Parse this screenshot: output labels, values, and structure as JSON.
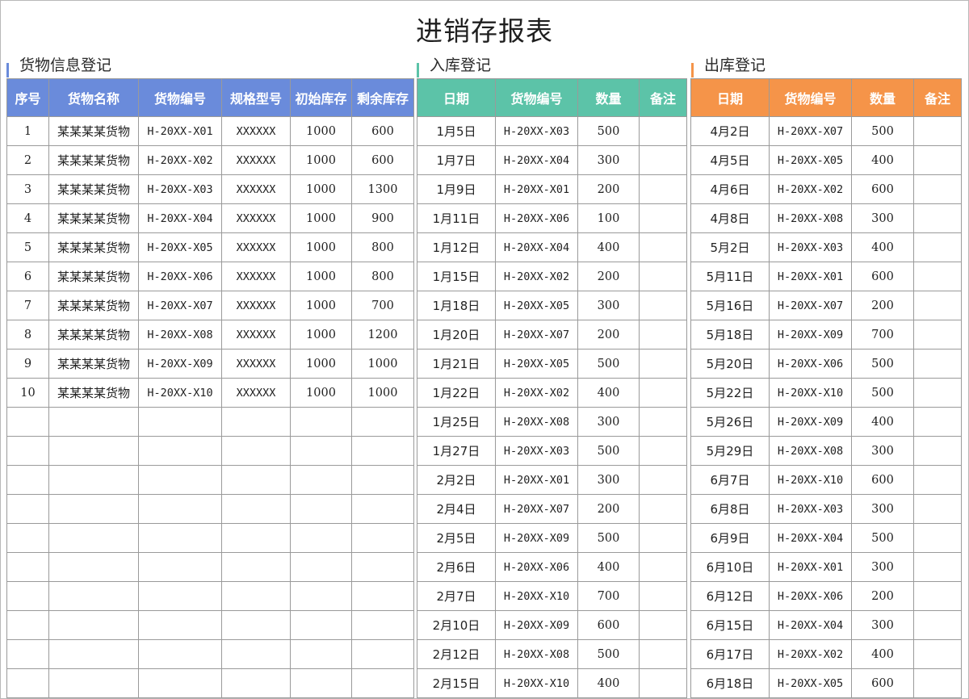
{
  "title": "进销存报表",
  "colors": {
    "goods": "#6a8bdb",
    "in": "#5cc3a8",
    "out": "#f59449"
  },
  "goods": {
    "label": "货物信息登记",
    "headers": [
      "序号",
      "货物名称",
      "货物编号",
      "规格型号",
      "初始库存",
      "剩余库存"
    ],
    "rows": [
      [
        "1",
        "某某某某货物",
        "H-20XX-X01",
        "XXXXXX",
        "1000",
        "600"
      ],
      [
        "2",
        "某某某某货物",
        "H-20XX-X02",
        "XXXXXX",
        "1000",
        "600"
      ],
      [
        "3",
        "某某某某货物",
        "H-20XX-X03",
        "XXXXXX",
        "1000",
        "1300"
      ],
      [
        "4",
        "某某某某货物",
        "H-20XX-X04",
        "XXXXXX",
        "1000",
        "900"
      ],
      [
        "5",
        "某某某某货物",
        "H-20XX-X05",
        "XXXXXX",
        "1000",
        "800"
      ],
      [
        "6",
        "某某某某货物",
        "H-20XX-X06",
        "XXXXXX",
        "1000",
        "800"
      ],
      [
        "7",
        "某某某某货物",
        "H-20XX-X07",
        "XXXXXX",
        "1000",
        "700"
      ],
      [
        "8",
        "某某某某货物",
        "H-20XX-X08",
        "XXXXXX",
        "1000",
        "1200"
      ],
      [
        "9",
        "某某某某货物",
        "H-20XX-X09",
        "XXXXXX",
        "1000",
        "1000"
      ],
      [
        "10",
        "某某某某货物",
        "H-20XX-X10",
        "XXXXXX",
        "1000",
        "1000"
      ],
      [
        "",
        "",
        "",
        "",
        "",
        ""
      ],
      [
        "",
        "",
        "",
        "",
        "",
        ""
      ],
      [
        "",
        "",
        "",
        "",
        "",
        ""
      ],
      [
        "",
        "",
        "",
        "",
        "",
        ""
      ],
      [
        "",
        "",
        "",
        "",
        "",
        ""
      ],
      [
        "",
        "",
        "",
        "",
        "",
        ""
      ],
      [
        "",
        "",
        "",
        "",
        "",
        ""
      ],
      [
        "",
        "",
        "",
        "",
        "",
        ""
      ],
      [
        "",
        "",
        "",
        "",
        "",
        ""
      ],
      [
        "",
        "",
        "",
        "",
        "",
        ""
      ]
    ]
  },
  "inbound": {
    "label": "入库登记",
    "headers": [
      "日期",
      "货物编号",
      "数量",
      "备注"
    ],
    "rows": [
      [
        "1月5日",
        "H-20XX-X03",
        "500",
        ""
      ],
      [
        "1月7日",
        "H-20XX-X04",
        "300",
        ""
      ],
      [
        "1月9日",
        "H-20XX-X01",
        "200",
        ""
      ],
      [
        "1月11日",
        "H-20XX-X06",
        "100",
        ""
      ],
      [
        "1月12日",
        "H-20XX-X04",
        "400",
        ""
      ],
      [
        "1月15日",
        "H-20XX-X02",
        "200",
        ""
      ],
      [
        "1月18日",
        "H-20XX-X05",
        "300",
        ""
      ],
      [
        "1月20日",
        "H-20XX-X07",
        "200",
        ""
      ],
      [
        "1月21日",
        "H-20XX-X05",
        "500",
        ""
      ],
      [
        "1月22日",
        "H-20XX-X02",
        "400",
        ""
      ],
      [
        "1月25日",
        "H-20XX-X08",
        "300",
        ""
      ],
      [
        "1月27日",
        "H-20XX-X03",
        "500",
        ""
      ],
      [
        "2月2日",
        "H-20XX-X01",
        "300",
        ""
      ],
      [
        "2月4日",
        "H-20XX-X07",
        "200",
        ""
      ],
      [
        "2月5日",
        "H-20XX-X09",
        "500",
        ""
      ],
      [
        "2月6日",
        "H-20XX-X06",
        "400",
        ""
      ],
      [
        "2月7日",
        "H-20XX-X10",
        "700",
        ""
      ],
      [
        "2月10日",
        "H-20XX-X09",
        "600",
        ""
      ],
      [
        "2月12日",
        "H-20XX-X08",
        "500",
        ""
      ],
      [
        "2月15日",
        "H-20XX-X10",
        "400",
        ""
      ]
    ]
  },
  "outbound": {
    "label": "出库登记",
    "headers": [
      "日期",
      "货物编号",
      "数量",
      "备注"
    ],
    "rows": [
      [
        "4月2日",
        "H-20XX-X07",
        "500",
        ""
      ],
      [
        "4月5日",
        "H-20XX-X05",
        "400",
        ""
      ],
      [
        "4月6日",
        "H-20XX-X02",
        "600",
        ""
      ],
      [
        "4月8日",
        "H-20XX-X08",
        "300",
        ""
      ],
      [
        "5月2日",
        "H-20XX-X03",
        "400",
        ""
      ],
      [
        "5月11日",
        "H-20XX-X01",
        "600",
        ""
      ],
      [
        "5月16日",
        "H-20XX-X07",
        "200",
        ""
      ],
      [
        "5月18日",
        "H-20XX-X09",
        "700",
        ""
      ],
      [
        "5月20日",
        "H-20XX-X06",
        "500",
        ""
      ],
      [
        "5月22日",
        "H-20XX-X10",
        "500",
        ""
      ],
      [
        "5月26日",
        "H-20XX-X09",
        "400",
        ""
      ],
      [
        "5月29日",
        "H-20XX-X08",
        "300",
        ""
      ],
      [
        "6月7日",
        "H-20XX-X10",
        "600",
        ""
      ],
      [
        "6月8日",
        "H-20XX-X03",
        "300",
        ""
      ],
      [
        "6月9日",
        "H-20XX-X04",
        "500",
        ""
      ],
      [
        "6月10日",
        "H-20XX-X01",
        "300",
        ""
      ],
      [
        "6月12日",
        "H-20XX-X06",
        "200",
        ""
      ],
      [
        "6月15日",
        "H-20XX-X04",
        "300",
        ""
      ],
      [
        "6月17日",
        "H-20XX-X02",
        "400",
        ""
      ],
      [
        "6月18日",
        "H-20XX-X05",
        "600",
        ""
      ]
    ]
  }
}
